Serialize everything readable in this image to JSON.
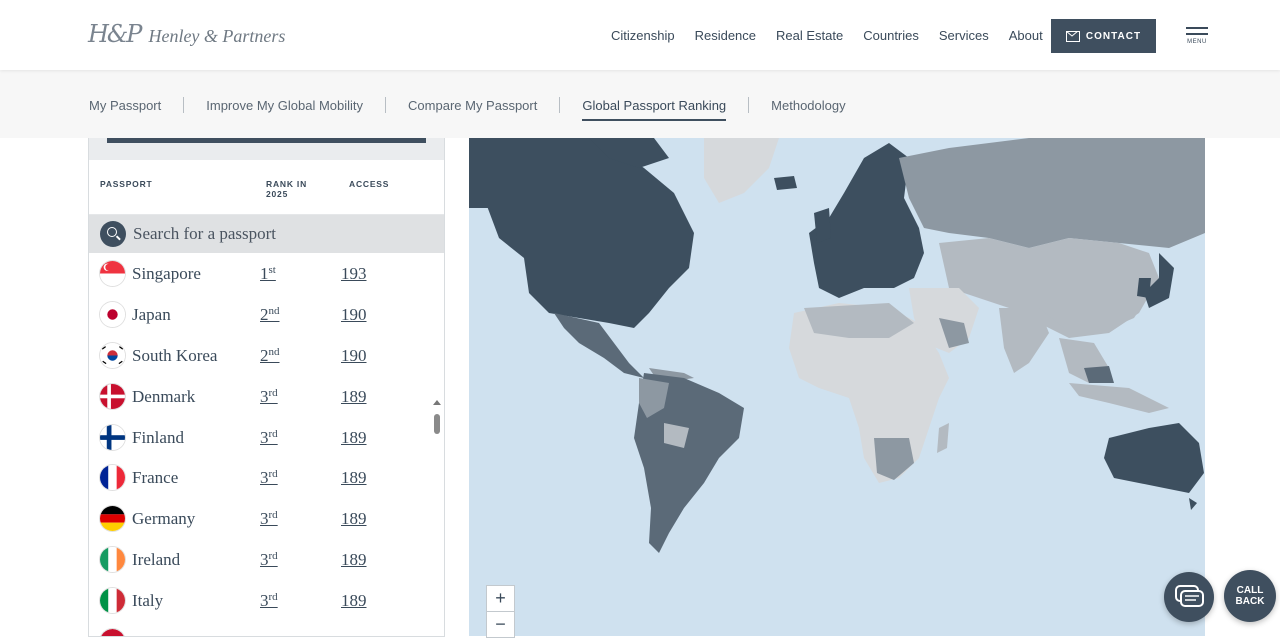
{
  "brand": {
    "mark": "H&P",
    "name": "Henley & Partners"
  },
  "nav": {
    "items": [
      "Citizenship",
      "Residence",
      "Real Estate",
      "Countries",
      "Services",
      "About"
    ],
    "contact_label": "CONTACT",
    "menu_label": "MENU"
  },
  "subnav": {
    "items": [
      "My Passport",
      "Improve My Global Mobility",
      "Compare My Passport",
      "Global Passport Ranking",
      "Methodology"
    ],
    "active": "Global Passport Ranking"
  },
  "table": {
    "col_passport": "PASSPORT",
    "col_rank": "RANK IN 2025",
    "col_access": "ACCESS",
    "search_placeholder": "Search for a passport",
    "rows": [
      {
        "country": "Singapore",
        "rank": "1",
        "suffix": "st",
        "access": "193",
        "flag": "singapore-flag-icon"
      },
      {
        "country": "Japan",
        "rank": "2",
        "suffix": "nd",
        "access": "190",
        "flag": "japan-flag-icon"
      },
      {
        "country": "South Korea",
        "rank": "2",
        "suffix": "nd",
        "access": "190",
        "flag": "south-korea-flag-icon"
      },
      {
        "country": "Denmark",
        "rank": "3",
        "suffix": "rd",
        "access": "189",
        "flag": "denmark-flag-icon"
      },
      {
        "country": "Finland",
        "rank": "3",
        "suffix": "rd",
        "access": "189",
        "flag": "finland-flag-icon"
      },
      {
        "country": "France",
        "rank": "3",
        "suffix": "rd",
        "access": "189",
        "flag": "france-flag-icon"
      },
      {
        "country": "Germany",
        "rank": "3",
        "suffix": "rd",
        "access": "189",
        "flag": "germany-flag-icon"
      },
      {
        "country": "Ireland",
        "rank": "3",
        "suffix": "rd",
        "access": "189",
        "flag": "ireland-flag-icon"
      },
      {
        "country": "Italy",
        "rank": "3",
        "suffix": "rd",
        "access": "189",
        "flag": "italy-flag-icon"
      }
    ]
  },
  "map": {
    "zoom_in": "+",
    "zoom_out": "−"
  },
  "floating": {
    "chat_icon": "chat-icon",
    "call_back_label": "CALL\nBACK"
  },
  "colors": {
    "brand_dark": "#3f4f5f",
    "map_water": "#cfe1ef",
    "tier_top": "#3d4f5f",
    "tier_mid": "#5b6a78",
    "tier_low": "#8d98a2",
    "tier_lower": "#b3bac1",
    "tier_lowest": "#d6d9dc"
  }
}
